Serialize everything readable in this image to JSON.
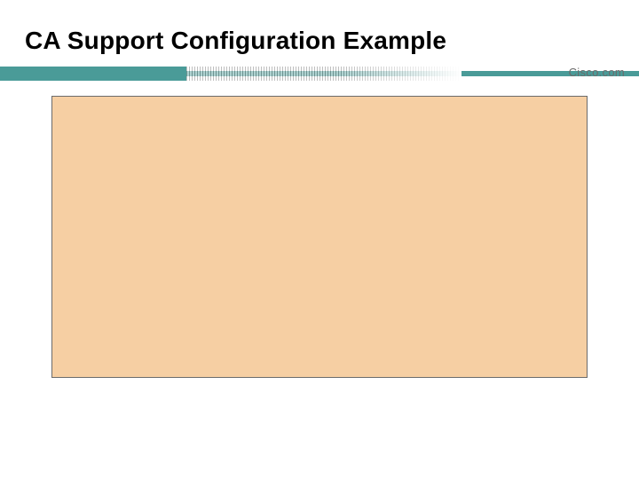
{
  "slide": {
    "title": "CA Support Configuration Example",
    "brand": "Cisco.com"
  }
}
